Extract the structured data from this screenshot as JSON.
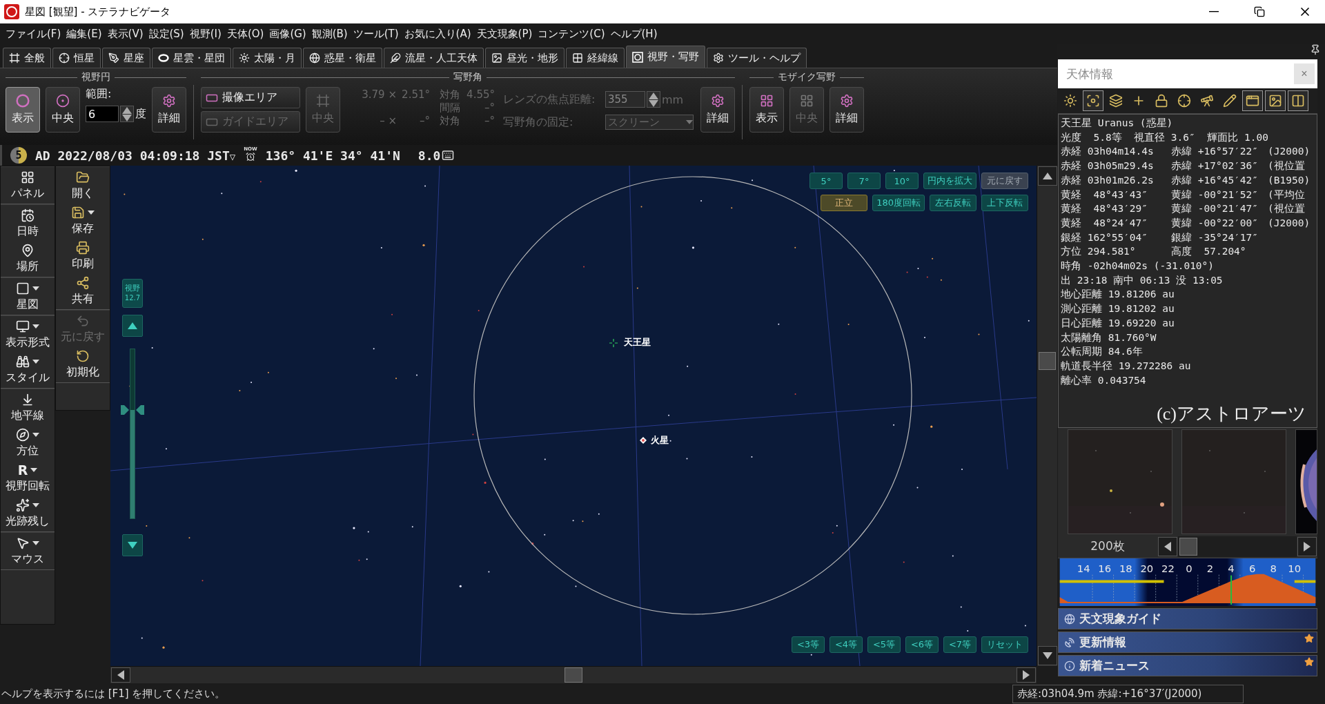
{
  "window": {
    "title": "星図 [観望] - ステラナビゲータ"
  },
  "menu": [
    "ファイル(F)",
    "編集(E)",
    "表示(V)",
    "設定(S)",
    "視野(I)",
    "天体(O)",
    "画像(G)",
    "観測(B)",
    "ツール(T)",
    "お気に入り(A)",
    "天文現象(P)",
    "コンテンツ(C)",
    "ヘルプ(H)"
  ],
  "tabs": [
    {
      "label": "全般",
      "selected": false
    },
    {
      "label": "恒星",
      "selected": false
    },
    {
      "label": "星座",
      "selected": false
    },
    {
      "label": "星雲・星団",
      "selected": false
    },
    {
      "label": "太陽・月",
      "selected": false
    },
    {
      "label": "惑星・衛星",
      "selected": false
    },
    {
      "label": "流星・人工天体",
      "selected": false
    },
    {
      "label": "昼光・地形",
      "selected": false
    },
    {
      "label": "経緯線",
      "selected": false
    },
    {
      "label": "視野・写野",
      "selected": true
    },
    {
      "label": "ツール・ヘルプ",
      "selected": false
    }
  ],
  "ribbon": {
    "fov_circle": {
      "title": "視野円",
      "show_button": {
        "label": "表示",
        "selected": true
      },
      "center_button": {
        "label": "中央"
      },
      "range_label": "範囲:",
      "range_value": "6",
      "range_unit": "度",
      "detail_button": {
        "label": "詳細"
      }
    },
    "sensor": {
      "title": "写野角",
      "area_buttons": [
        {
          "label": "撮像エリア",
          "disabled": false
        },
        {
          "label": "ガイドエリア",
          "disabled": true
        }
      ],
      "center_button": {
        "label": "中央",
        "disabled": true
      },
      "readouts_disabled": true,
      "readouts": [
        {
          "kind": "size",
          "width": "3.79 ×",
          "height": "2.51°",
          "diagonal_label": "対角",
          "diagonal": "4.55°"
        },
        {
          "kind": "spacing",
          "label": "間隔",
          "value": "–°"
        },
        {
          "kind": "size",
          "width": "– ×",
          "height": "–°",
          "diagonal_label": "対角",
          "diagonal": "–°"
        }
      ],
      "focal": {
        "label": "レンズの焦点距離:",
        "value": "355",
        "unit": "mm",
        "disabled": true
      },
      "fix": {
        "label": "写野角の固定:",
        "value": "スクリーン",
        "disabled": true
      },
      "detail_button": {
        "label": "詳細"
      }
    },
    "mosaic": {
      "title": "モザイク写野",
      "buttons": [
        {
          "label": "表示",
          "disabled": false
        },
        {
          "label": "中央",
          "disabled": true
        },
        {
          "label": "詳細",
          "disabled": false
        }
      ]
    }
  },
  "status_line": {
    "moon_age": "5",
    "datetime": "AD 2022/08/03 04:09:18 JST",
    "caret": "▽",
    "now_badge": "NOW",
    "location": "136° 41'E 34° 41'N",
    "zoom": "8.0"
  },
  "sidebar": {
    "panel_groups": [
      [
        {
          "label": "パネル",
          "dropdown": false
        }
      ],
      [
        {
          "label": "日時",
          "dropdown": false
        },
        {
          "label": "場所",
          "dropdown": false
        }
      ],
      [
        {
          "label": "星図",
          "dropdown": true
        }
      ],
      [
        {
          "label": "表示形式",
          "dropdown": true
        },
        {
          "label": "スタイル",
          "dropdown": true
        }
      ],
      [
        {
          "label": "地平線",
          "dropdown": false
        },
        {
          "label": "方位",
          "dropdown": true
        },
        {
          "label": "視野回転",
          "dropdown": true,
          "icon_char": "R"
        },
        {
          "label": "光跡残し",
          "dropdown": true
        }
      ],
      [
        {
          "label": "マウス",
          "dropdown": true
        }
      ]
    ],
    "file_groups": [
      [
        {
          "label": "開く",
          "dropdown": false,
          "disabled": false
        },
        {
          "label": "保存",
          "dropdown": true,
          "disabled": false
        },
        {
          "label": "印刷",
          "dropdown": false,
          "disabled": false
        },
        {
          "label": "共有",
          "dropdown": false,
          "disabled": false
        }
      ],
      [
        {
          "label": "元に戻す",
          "dropdown": false,
          "disabled": true
        },
        {
          "label": "初期化",
          "dropdown": false,
          "disabled": false
        }
      ]
    ]
  },
  "map": {
    "fov_badge": {
      "label": "視野",
      "value": "12.7"
    },
    "zoom_slider": {
      "level": 0.64
    },
    "objects": [
      {
        "label": "天王星",
        "kind": "target"
      },
      {
        "label": "火星",
        "kind": "planet"
      }
    ],
    "fov_buttons": [
      {
        "label": "5°",
        "disabled": false
      },
      {
        "label": "7°",
        "disabled": false
      },
      {
        "label": "10°",
        "disabled": false
      },
      {
        "label": "円内を拡大",
        "disabled": false
      },
      {
        "label": "元に戻す",
        "disabled": true
      }
    ],
    "orientation_buttons": [
      {
        "label": "正立",
        "selected": true
      },
      {
        "label": "180度回転",
        "selected": false
      },
      {
        "label": "左右反転",
        "selected": false
      },
      {
        "label": "上下反転",
        "selected": false
      }
    ],
    "magnitude_buttons": [
      "<3等",
      "<4等",
      "<5等",
      "<6等",
      "<7等",
      "リセット"
    ]
  },
  "info_panel": {
    "title": "天体情報",
    "close": "×",
    "toolbar": [
      {
        "selected": false
      },
      {
        "selected": true
      },
      {
        "selected": false
      },
      {
        "selected": false
      },
      {
        "selected": false
      },
      {
        "selected": false
      },
      {
        "selected": false
      },
      {
        "selected": false
      },
      {
        "selected": true
      },
      {
        "selected": true
      },
      {
        "selected": true
      }
    ],
    "lines": [
      [
        "天王星 Uranus (惑星)"
      ],
      [
        "光度  5.8等  視直径 3.6″  輝面比 1.00"
      ],
      [
        "赤経 03h04m14.4s",
        "赤緯 +16°57′22″",
        "(J2000)"
      ],
      [
        "赤経 03h05m29.4s",
        "赤緯 +17°02′36″",
        "(視位置"
      ],
      [
        "赤経 03h01m26.2s",
        "赤緯 +16°45′42″",
        "(B1950)"
      ],
      [
        "黄経  48°43′43″",
        "黄緯 -00°21′52″",
        "(平均位"
      ],
      [
        "黄経  48°43′29″",
        "黄緯 -00°21′47″",
        "(視位置"
      ],
      [
        "黄経  48°24′47″",
        "黄緯 -00°22′00″",
        "(J2000)"
      ],
      [
        "銀経 162°55′04″",
        "銀緯 -35°24′17″"
      ],
      [
        "方位 294.581°",
        "高度  57.204°"
      ],
      [
        "時角 -02h04m02s (-31.010°)"
      ],
      [
        "出 23:18 南中 06:13 没 13:05"
      ],
      [
        "地心距離 19.81206 au"
      ],
      [
        "測心距離 19.81202 au"
      ],
      [
        "日心距離 19.69220 au"
      ],
      [
        "太陽離角 81.760°W"
      ],
      [
        "公転周期 84.6年"
      ],
      [
        "軌道長半径 19.272286 au"
      ],
      [
        "離心率 0.043754"
      ]
    ],
    "credit": "(c)アストロアーツ",
    "thumbnails": [
      {
        "kind": "picture"
      },
      {
        "kind": "picture"
      },
      {
        "kind": "picture"
      }
    ],
    "count": "200枚",
    "timeline_hours": [
      "14",
      "16",
      "18",
      "20",
      "22",
      "0",
      "2",
      "4",
      "6",
      "8",
      "10"
    ],
    "guides": [
      {
        "label": "天文現象ガイド",
        "new": false
      },
      {
        "label": "更新情報",
        "new": true
      },
      {
        "label": "新着ニュース",
        "new": true
      }
    ]
  },
  "status_bar": {
    "help": "ヘルプを表示するには [F1] を押してください。",
    "coordinates": "赤経:03h04.9m 赤緯:+16°37′(J2000)"
  }
}
